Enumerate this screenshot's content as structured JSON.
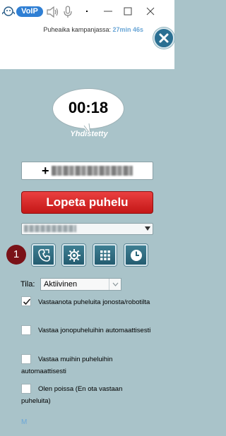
{
  "topbar": {
    "voip_badge": "VoIP",
    "talk_time_label": "Puheaika kampanjassa:",
    "talk_time_value": "27min 46s"
  },
  "call": {
    "timer": "00:18",
    "status": "Yhdistetty",
    "number_prefix": "+"
  },
  "hangup_label": "Lopeta puhelu",
  "step_badge": "1",
  "toolbar_buttons": [
    "phone-transfer-icon",
    "gear-icon",
    "keypad-icon",
    "clock-icon"
  ],
  "status": {
    "label": "Tila:",
    "value": "Aktiivinen"
  },
  "checkboxes": [
    {
      "label": "Vastaanota puheluita jonosta/robotilta",
      "checked": true
    },
    {
      "label": "Vastaa jonopuheluihin automaattisesti",
      "checked": false
    },
    {
      "label": "Vastaa muihin puheluihin automaattisesti",
      "checked": false
    },
    {
      "label": "Olen poissa (En ota vastaan puheluita)",
      "checked": false
    }
  ],
  "footer_mark": "M",
  "colors": {
    "panel_bg": "#a9c3c9",
    "accent_blue": "#2f7fd4",
    "hangup_red": "#d62424",
    "tool_button": "#2f6f84",
    "badge_maroon": "#7a1218"
  }
}
